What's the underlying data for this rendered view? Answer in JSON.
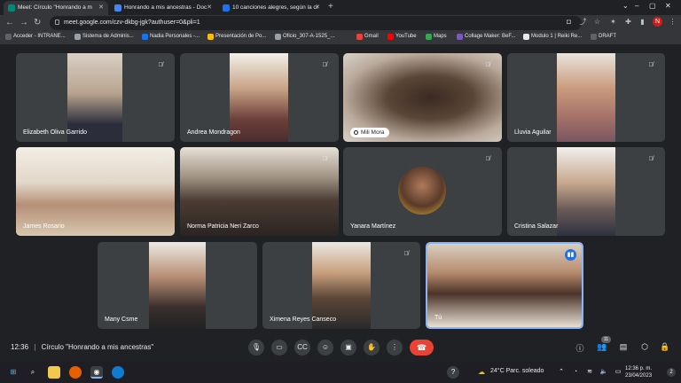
{
  "browser": {
    "tabs": [
      {
        "title": "Meet: Círculo \"Honrando a m",
        "active": true,
        "favicon_color": "#00897b"
      },
      {
        "title": "Honrando a mis ancestras - Doc",
        "active": false,
        "favicon_color": "#4285f4"
      },
      {
        "title": "10 canciones alegres, según la ci",
        "active": false,
        "favicon_color": "#1a73e8"
      }
    ],
    "address": "meet.google.com/czv-dkbg-jgk?authuser=0&pli=1",
    "bookmarks": [
      "Acceder - INTRANE...",
      "Sistema de Adminis...",
      "Nadia Personales -...",
      "Presentación de Po...",
      "Oficio_307-A-1525_...",
      "Gmail",
      "YouTube",
      "Maps",
      "Collage Maker: BeF...",
      "Modulo 1 | Reiki Re...",
      "DRAFT"
    ],
    "avatar_letter": "N"
  },
  "participants": [
    {
      "name": "Elizabeth Oliva Garrido",
      "muted": true
    },
    {
      "name": "Andrea Mondragon",
      "muted": true
    },
    {
      "name": "Mili Mora",
      "muted": true
    },
    {
      "name": "Lluvia Aguilar",
      "muted": true
    },
    {
      "name": "James Rosario",
      "muted": true
    },
    {
      "name": "Norma Patricia Neri Zarco",
      "muted": true
    },
    {
      "name": "Yanara Martínez",
      "muted": true
    },
    {
      "name": "Cristina Salazar",
      "muted": true
    },
    {
      "name": "Many Csme",
      "muted": false
    },
    {
      "name": "Ximena Reyes Canseco",
      "muted": true
    },
    {
      "name": "Tú",
      "muted": false,
      "speaking": true
    }
  ],
  "meeting": {
    "time": "12:36",
    "separator": "|",
    "title": "Círculo \"Honrando a mis ancestras\"",
    "participant_count": "11"
  },
  "taskbar": {
    "weather": "24°C  Parc. soleado",
    "clock_time": "12:36 p. m.",
    "clock_date": "23/04/2023",
    "notifications": "2"
  },
  "colors": {
    "accent": "#8ab4f8",
    "end_call": "#ea4335",
    "speaking": "#1a73e8"
  }
}
